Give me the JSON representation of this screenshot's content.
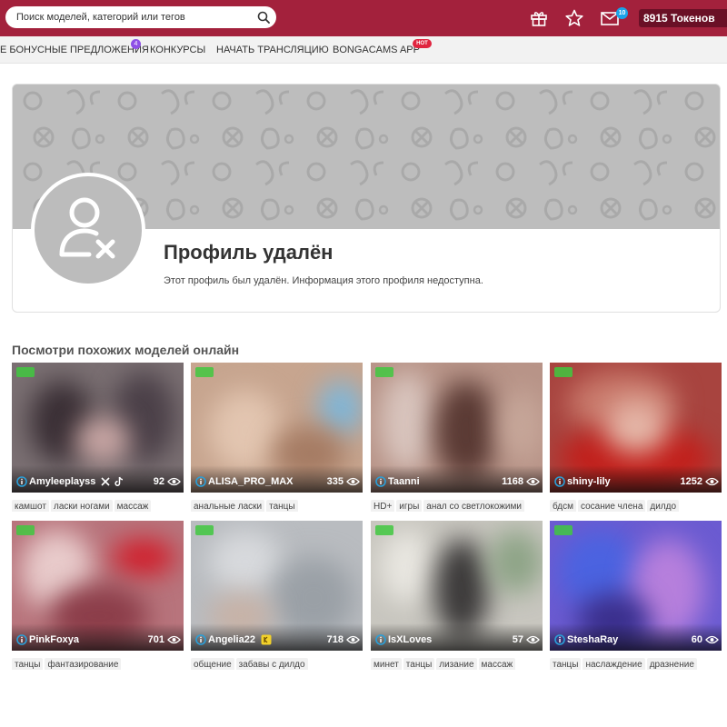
{
  "header": {
    "search_placeholder": "Поиск моделей, категорий или тегов",
    "mail_count": "10",
    "tokens_label": "8915 Токенов"
  },
  "nav": {
    "items": [
      {
        "label": "Е БОНУСНЫЕ ПРЕДЛОЖЕНИЯ",
        "badge": "4"
      },
      {
        "label": "КОНКУРСЫ"
      },
      {
        "label": "НАЧАТЬ ТРАНСЛЯЦИЮ"
      },
      {
        "label": "BONGACAMS APP",
        "badge": "HOT"
      }
    ]
  },
  "profile": {
    "title": "Профиль удалён",
    "description": "Этот профиль был удалён. Информация этого профиля недоступна."
  },
  "similar": {
    "title": "Посмотри похожих моделей онлайн",
    "models": [
      {
        "name": "Amyleeplayss",
        "viewers": "92",
        "tags": [
          "камшот",
          "ласки ногами",
          "массаж"
        ],
        "icons": [
          "x-icon",
          "tiktok-icon"
        ]
      },
      {
        "name": "ALISA_PRO_MAX",
        "viewers": "335",
        "tags": [
          "анальные ласки",
          "танцы"
        ]
      },
      {
        "name": "Taanni",
        "viewers": "1168",
        "tags": [
          "HD+",
          "игры",
          "анал со светлокожими"
        ]
      },
      {
        "name": "shiny-lily",
        "viewers": "1252",
        "tags": [
          "бдсм",
          "сосание члена",
          "дилдо"
        ]
      },
      {
        "name": "PinkFoxya",
        "viewers": "701",
        "tags": [
          "танцы",
          "фантазирование"
        ]
      },
      {
        "name": "Angelia22",
        "viewers": "718",
        "tags": [
          "общение",
          "забавы с дилдо"
        ],
        "icons": [
          "gold-badge-icon"
        ]
      },
      {
        "name": "IsXLoves",
        "viewers": "57",
        "tags": [
          "минет",
          "танцы",
          "лизание",
          "массаж"
        ]
      },
      {
        "name": "SteshaRay",
        "viewers": "60",
        "tags": [
          "танцы",
          "наслаждение",
          "дразнение"
        ]
      }
    ]
  },
  "colors": {
    "header_bg": "#a3213c",
    "tokens_bg": "#6a1026",
    "live_badge": "#41c840",
    "hot_badge": "#e0243f",
    "bonus_badge": "#8e4fe6",
    "mail_badge": "#1aa3e8"
  }
}
